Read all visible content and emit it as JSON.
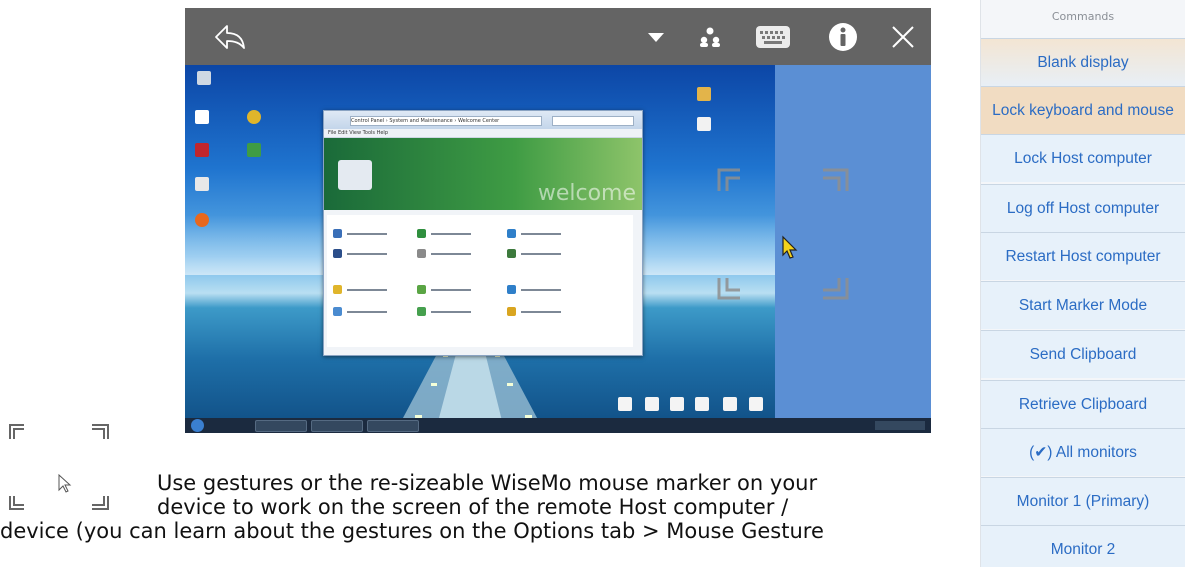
{
  "toolbar": {
    "icons": [
      "back-arrow-icon",
      "dropdown-caret-icon",
      "users-icon",
      "keyboard-icon",
      "info-icon",
      "close-icon"
    ]
  },
  "remote_desktop": {
    "window_title": "Control Panel › System and Maintenance › Welcome Center",
    "menu": "File  Edit  View  Tools  Help",
    "hero_text": "welcome"
  },
  "caption": {
    "line1": "Use gestures or the re-sizeable WiseMo mouse marker on your",
    "line2": "device to work on the screen of the remote Host computer /",
    "line3": "device (you can learn about the gestures on the Options tab > Mouse Gesture"
  },
  "commands": {
    "header": "Commands",
    "items": [
      {
        "label": "Blank display"
      },
      {
        "label": "Lock keyboard and mouse"
      },
      {
        "label": "Lock Host computer"
      },
      {
        "label": "Log off Host computer"
      },
      {
        "label": "Restart Host computer"
      },
      {
        "label": "Start Marker Mode"
      },
      {
        "label": "Send Clipboard"
      },
      {
        "label": "Retrieve Clipboard"
      },
      {
        "label": "(✔) All monitors"
      },
      {
        "label": "Monitor 1 (Primary)"
      },
      {
        "label": "Monitor 2"
      }
    ]
  },
  "colors": {
    "toolbar": "#646464",
    "command_text": "#2b6cc4",
    "command_bg": "#e7f1fa",
    "command_highlight": "#f1dcc2",
    "viewer_side": "#5b8fd4"
  }
}
